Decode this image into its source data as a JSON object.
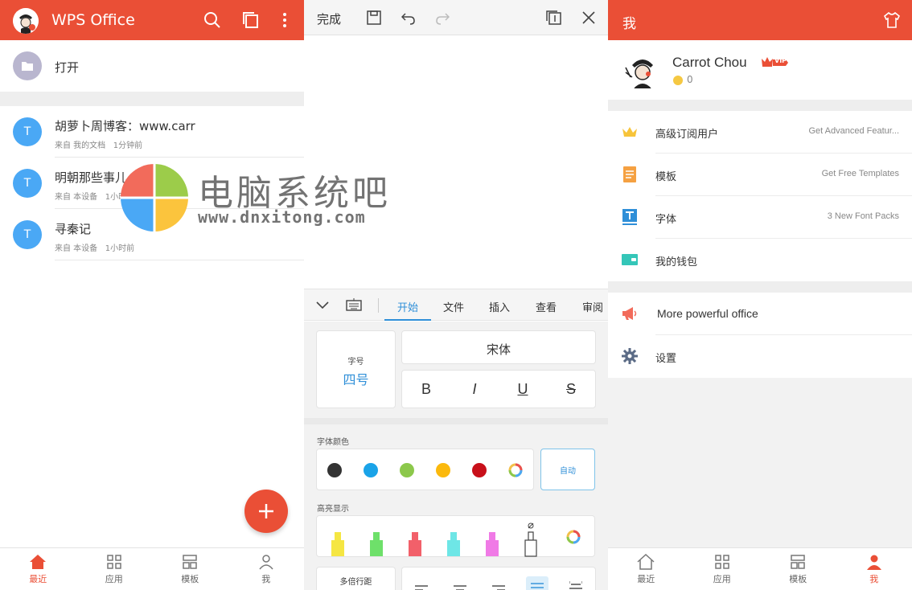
{
  "home": {
    "app_title": "WPS Office",
    "open_label": "打开",
    "files": [
      {
        "icon_letter": "T",
        "name": "胡萝卜周博客：www.carr",
        "source": "来自 我的文档",
        "time": "1分钟前"
      },
      {
        "icon_letter": "T",
        "name": "明朝那些事儿",
        "source": "来自 本设备",
        "time": "1小时前"
      },
      {
        "icon_letter": "T",
        "name": "寻秦记",
        "source": "来自 本设备",
        "time": "1小时前"
      }
    ],
    "fab_icon": "plus-icon",
    "nav": [
      {
        "label": "最近",
        "icon": "home-icon"
      },
      {
        "label": "应用",
        "icon": "grid-icon"
      },
      {
        "label": "模板",
        "icon": "template-icon"
      },
      {
        "label": "我",
        "icon": "person-icon"
      }
    ]
  },
  "editor": {
    "done_label": "完成",
    "tabs": [
      "开始",
      "文件",
      "插入",
      "查看",
      "审阅"
    ],
    "font_size_title": "字号",
    "font_size_value": "四号",
    "font_name": "宋体",
    "format_buttons": [
      "B",
      "I",
      "U",
      "S"
    ],
    "font_color_label": "字体颜色",
    "font_colors": [
      "#333333",
      "#1aa3e8",
      "#8cc84b",
      "#fbb90d",
      "#c8101a"
    ],
    "auto_label": "自动",
    "highlight_label": "高亮显示",
    "highlight_colors": [
      "#f5e642",
      "#6ee06a",
      "#f2606a",
      "#6ee6e6",
      "#f07ae6"
    ],
    "line_spacing_label": "多倍行距"
  },
  "me": {
    "title": "我",
    "user_name": "Carrot Chou",
    "vip_label": "VIP",
    "coins": "0",
    "rows_a": [
      {
        "label": "高级订阅用户",
        "hint": "Get Advanced Featur...",
        "icon": "crown-icon"
      },
      {
        "label": "模板",
        "hint": "Get Free Templates",
        "icon": "template-doc-icon"
      },
      {
        "label": "字体",
        "hint": "3 New Font Packs",
        "icon": "font-icon"
      },
      {
        "label": "我的钱包",
        "hint": "",
        "icon": "wallet-icon"
      }
    ],
    "rows_b": [
      {
        "label": "More powerful office",
        "icon": "megaphone-icon"
      },
      {
        "label": "设置",
        "icon": "gear-icon"
      }
    ],
    "nav": [
      {
        "label": "最近",
        "icon": "home-icon"
      },
      {
        "label": "应用",
        "icon": "grid-icon"
      },
      {
        "label": "模板",
        "icon": "template-icon"
      },
      {
        "label": "我",
        "icon": "person-icon"
      }
    ]
  },
  "watermark": {
    "title": "电脑系统吧",
    "url": "www.dnxitong.com"
  },
  "colors": {
    "accent_red": "#ea4f36",
    "accent_blue": "#2f8fd8",
    "file_blue": "#4aa8f5"
  }
}
